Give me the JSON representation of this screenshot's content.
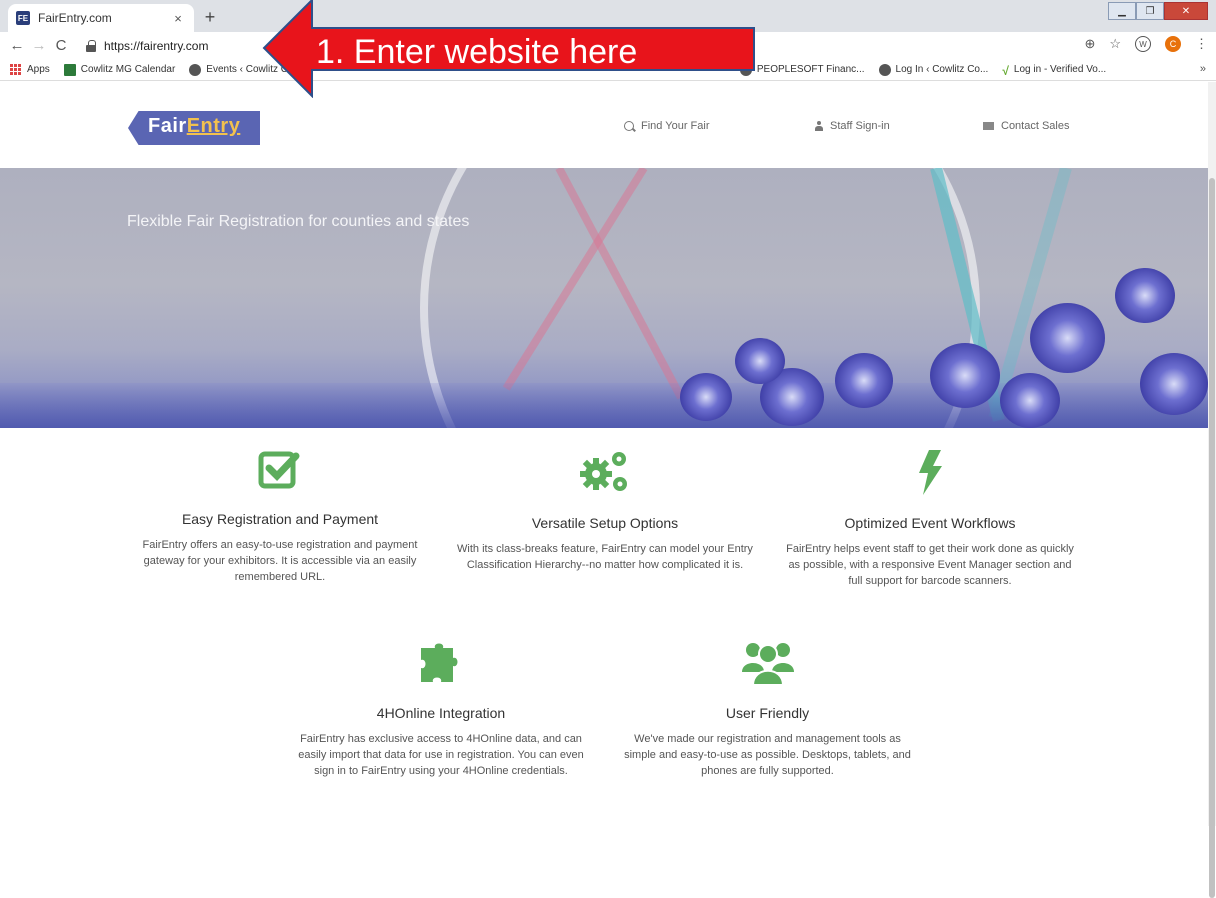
{
  "browser": {
    "tab_title": "FairEntry.com",
    "tab_favicon": "FE",
    "tab_close": "×",
    "new_tab": "+",
    "url": "https://fairentry.com",
    "bookmarks": [
      {
        "label": "Apps",
        "icon": "apps-icon"
      },
      {
        "label": "Cowlitz MG Calendar",
        "icon": "calendar-icon"
      },
      {
        "label": "Events ‹ Cowlitz Co...",
        "icon": "globe-icon"
      },
      {
        "label": "PEOPLESOFT Financ...",
        "icon": "globe-icon"
      },
      {
        "label": "Log In ‹ Cowlitz Co...",
        "icon": "globe-icon"
      },
      {
        "label": "Log in - Verified Vo...",
        "icon": "check-icon"
      }
    ],
    "bookmarks_more": "»",
    "profile_initial": "C"
  },
  "annotation": {
    "text": "1. Enter website here",
    "color": "#e8141b"
  },
  "site": {
    "logo_part1": "Fair",
    "logo_part2": "Entry",
    "nav": [
      {
        "label": "Find Your Fair",
        "icon": "search-icon"
      },
      {
        "label": "Staff Sign-in",
        "icon": "person-icon"
      },
      {
        "label": "Contact Sales",
        "icon": "mail-icon"
      }
    ],
    "hero_title": "Flexible Fair Registration for counties and states",
    "accent": "#5cad5c",
    "features": [
      {
        "icon": "checkbox-icon",
        "title": "Easy Registration and Payment",
        "desc": "FairEntry offers an easy-to-use registration and payment gateway for your exhibitors. It is accessible via an easily remembered URL."
      },
      {
        "icon": "gears-icon",
        "title": "Versatile Setup Options",
        "desc": "With its class-breaks feature, FairEntry can model your Entry Classification Hierarchy--no matter how complicated it is."
      },
      {
        "icon": "lightning-icon",
        "title": "Optimized Event Workflows",
        "desc": "FairEntry helps event staff to get their work done as quickly as possible, with a responsive Event Manager section and full support for barcode scanners."
      },
      {
        "icon": "puzzle-icon",
        "title": "4HOnline Integration",
        "desc": "FairEntry has exclusive access to 4HOnline data, and can easily import that data for use in registration. You can even sign in to FairEntry using your 4HOnline credentials."
      },
      {
        "icon": "users-icon",
        "title": "User Friendly",
        "desc": "We've made our registration and management tools as simple and easy-to-use as possible. Desktops, tablets, and phones are fully supported."
      }
    ]
  }
}
